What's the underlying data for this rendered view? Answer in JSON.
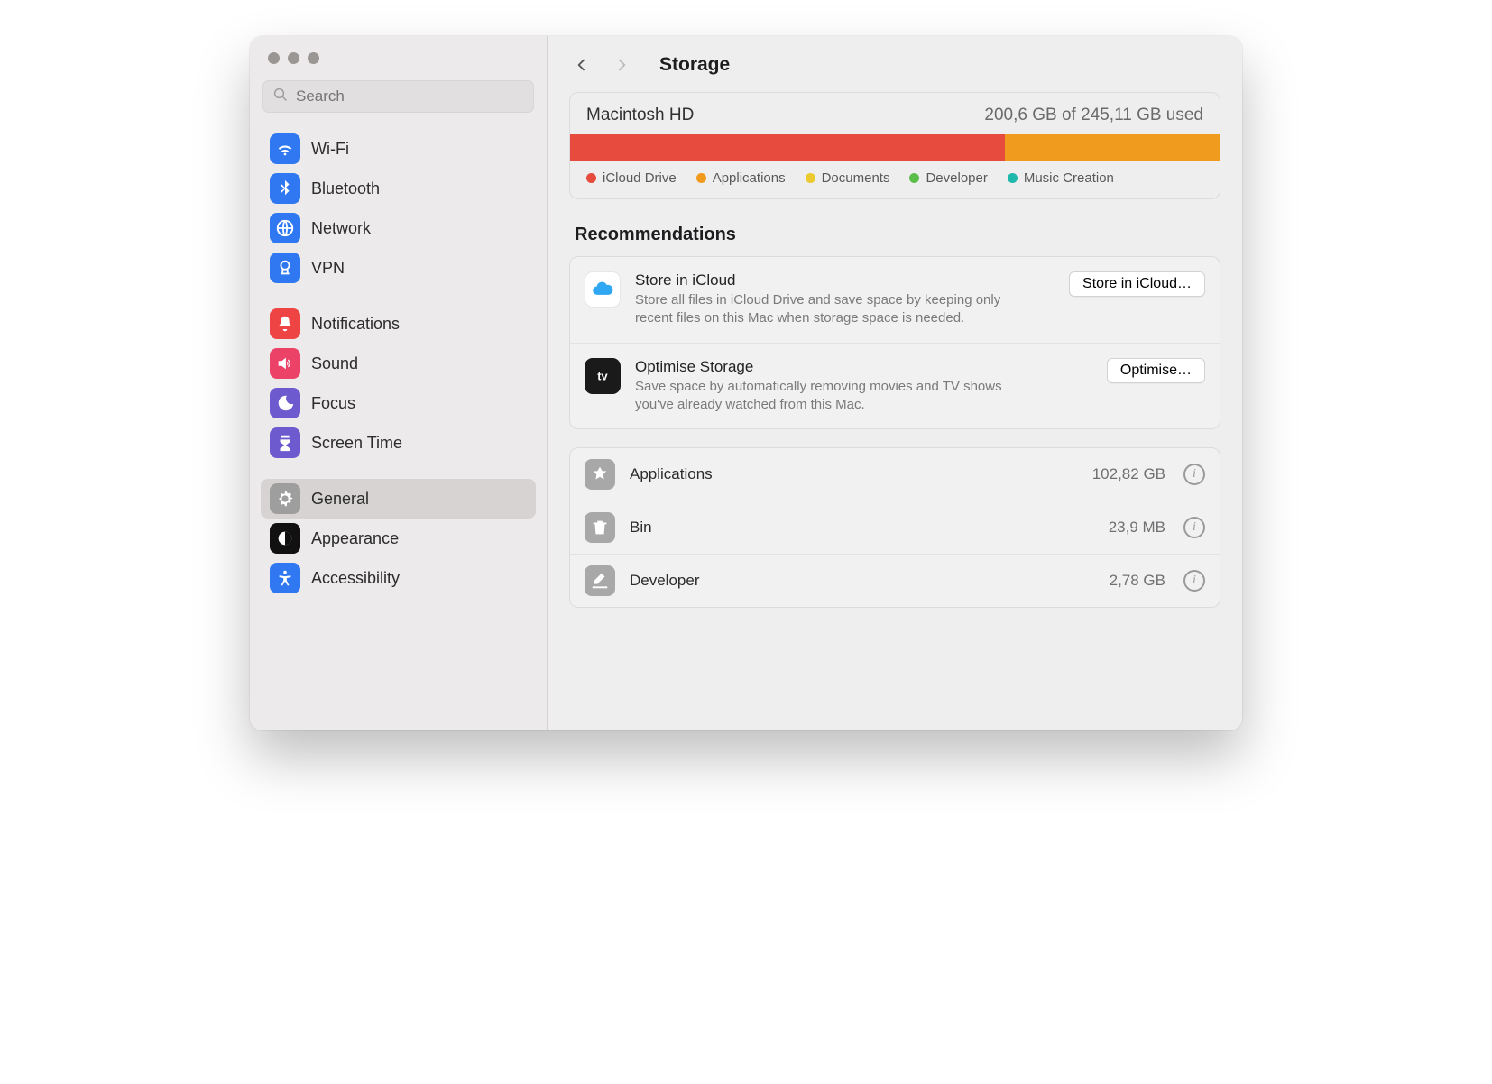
{
  "search": {
    "placeholder": "Search"
  },
  "header": {
    "title": "Storage"
  },
  "sidebar": {
    "groups": [
      {
        "items": [
          {
            "key": "wifi",
            "label": "Wi-Fi"
          },
          {
            "key": "bluetooth",
            "label": "Bluetooth"
          },
          {
            "key": "network",
            "label": "Network"
          },
          {
            "key": "vpn",
            "label": "VPN"
          }
        ]
      },
      {
        "items": [
          {
            "key": "notifications",
            "label": "Notifications"
          },
          {
            "key": "sound",
            "label": "Sound"
          },
          {
            "key": "focus",
            "label": "Focus"
          },
          {
            "key": "screentime",
            "label": "Screen Time"
          }
        ]
      },
      {
        "items": [
          {
            "key": "general",
            "label": "General",
            "selected": true
          },
          {
            "key": "appearance",
            "label": "Appearance"
          },
          {
            "key": "accessibility",
            "label": "Accessibility"
          }
        ]
      }
    ]
  },
  "disk": {
    "name": "Macintosh HD",
    "used_text": "200,6 GB of 245,11 GB used",
    "bar": [
      {
        "key": "icloud",
        "color": "#e64b3e",
        "percent": 67
      },
      {
        "key": "applications",
        "color": "#f09b1e",
        "percent": 33
      }
    ],
    "legend": [
      {
        "key": "icloud",
        "label": "iCloud Drive",
        "color": "#e64b3e"
      },
      {
        "key": "applications",
        "label": "Applications",
        "color": "#f09b1e"
      },
      {
        "key": "documents",
        "label": "Documents",
        "color": "#ecc92e"
      },
      {
        "key": "developer",
        "label": "Developer",
        "color": "#5bbd4a"
      },
      {
        "key": "music",
        "label": "Music Creation",
        "color": "#1fb8ad"
      }
    ]
  },
  "recommendations": {
    "heading": "Recommendations",
    "items": [
      {
        "key": "icloud",
        "title": "Store in iCloud",
        "desc": "Store all files in iCloud Drive and save space by keeping only recent files on this Mac when storage space is needed.",
        "button": "Store in iCloud…"
      },
      {
        "key": "optimise",
        "title": "Optimise Storage",
        "desc": "Save space by automatically removing movies and TV shows you've already watched from this Mac.",
        "button": "Optimise…"
      }
    ]
  },
  "categories": [
    {
      "key": "applications",
      "label": "Applications",
      "size": "102,82 GB"
    },
    {
      "key": "bin",
      "label": "Bin",
      "size": "23,9 MB"
    },
    {
      "key": "developer",
      "label": "Developer",
      "size": "2,78 GB"
    }
  ]
}
